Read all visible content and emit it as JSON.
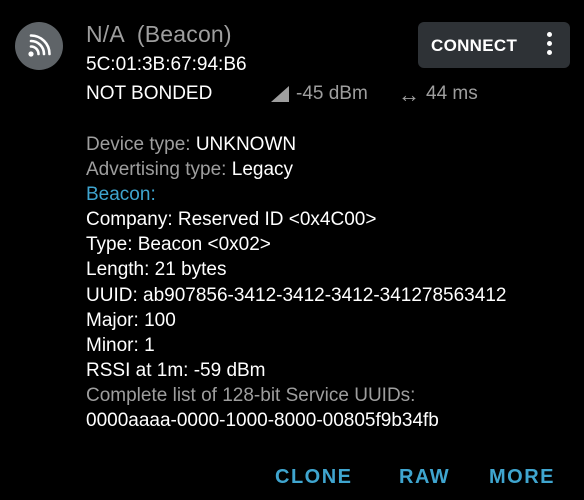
{
  "device": {
    "name": "N/A",
    "type_label": "(Beacon)",
    "mac": "5C:01:3B:67:94:B6",
    "bond_state": "NOT BONDED",
    "rssi": "-45 dBm",
    "interval": "44 ms",
    "avatar_icon": "beacon-signal-icon"
  },
  "toolbar": {
    "connect_label": "CONNECT",
    "overflow_icon": "more-vert-icon"
  },
  "details": {
    "device_type_key": "Device type: ",
    "device_type_value": "UNKNOWN",
    "adv_type_key": "Advertising type: ",
    "adv_type_value": "Legacy",
    "beacon_header": "Beacon:",
    "company": "Company: Reserved ID <0x4C00>",
    "type": "Type: Beacon <0x02>",
    "length": "Length: 21 bytes",
    "uuid": "UUID: ab907856-3412-3412-3412-341278563412",
    "major": "Major: 100",
    "minor": "Minor: 1",
    "rssi_1m": "RSSI at 1m: -59 dBm",
    "service_uuids_key": "Complete list of 128-bit Service UUIDs:",
    "service_uuids_value": "0000aaaa-0000-1000-8000-00805f9b34fb"
  },
  "actions": {
    "clone": "CLONE",
    "raw": "RAW",
    "more": "MORE"
  },
  "colors": {
    "accent": "#3fa5cf",
    "background": "#000000",
    "muted": "#9e9e9e",
    "button_bg": "#2e3236"
  }
}
